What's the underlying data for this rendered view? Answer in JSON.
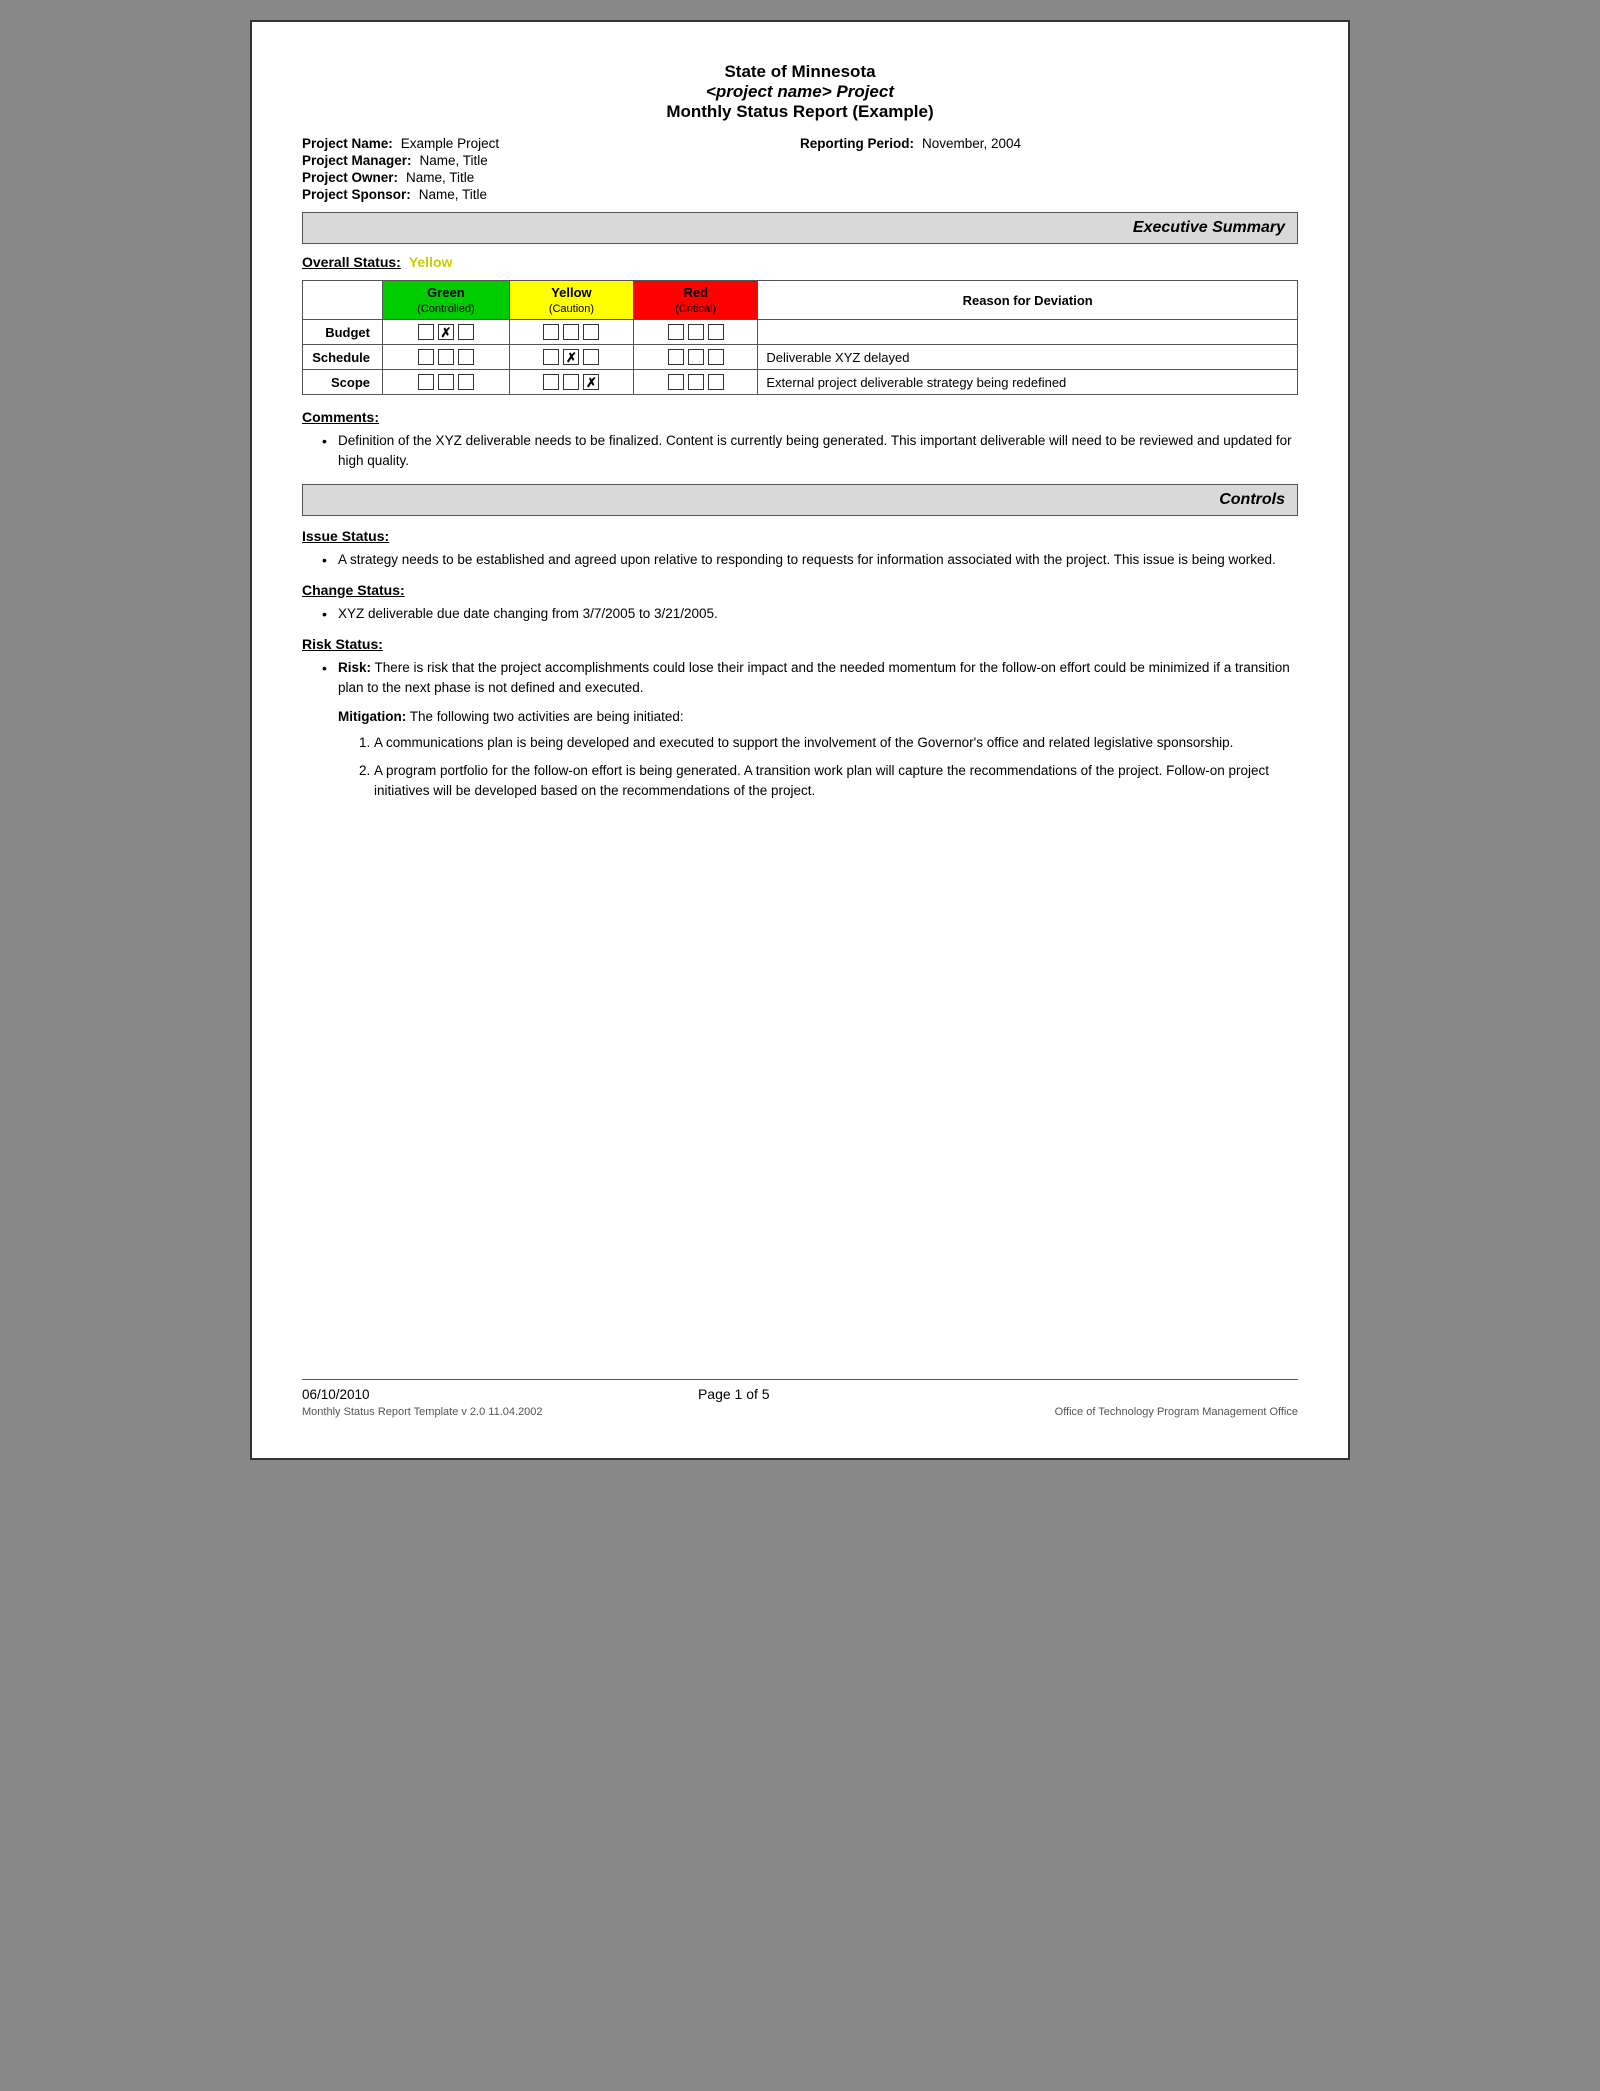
{
  "header": {
    "line1": "State of Minnesota",
    "line2": "<project name> Project",
    "line3": "Monthly Status Report (Example)"
  },
  "meta": {
    "project_name_label": "Project Name:",
    "project_name_value": "Example Project",
    "reporting_period_label": "Reporting Period:",
    "reporting_period_value": "November, 2004",
    "project_manager_label": "Project Manager:",
    "project_manager_value": "Name, Title",
    "project_owner_label": "Project Owner:",
    "project_owner_value": "Name, Title",
    "project_sponsor_label": "Project Sponsor:",
    "project_sponsor_value": "Name, Title"
  },
  "executive_summary": {
    "section_title": "Executive Summary"
  },
  "overall_status": {
    "label": "Overall Status:",
    "value": "Yellow"
  },
  "status_table": {
    "headers": {
      "green": "Green",
      "green_sub": "(Controlled)",
      "yellow": "Yellow",
      "yellow_sub": "(Caution)",
      "red": "Red",
      "red_sub": "(Critical)",
      "reason": "Reason for Deviation"
    },
    "rows": [
      {
        "label": "Budget",
        "green": [
          false,
          true,
          false
        ],
        "yellow": [
          false,
          false,
          false
        ],
        "red": [
          false,
          false,
          false
        ],
        "reason": ""
      },
      {
        "label": "Schedule",
        "green": [
          false,
          false,
          false
        ],
        "yellow": [
          false,
          true,
          false
        ],
        "red": [
          false,
          false,
          false
        ],
        "reason": "Deliverable XYZ delayed"
      },
      {
        "label": "Scope",
        "green": [
          false,
          false,
          false
        ],
        "yellow": [
          false,
          false,
          true
        ],
        "red": [
          false,
          false,
          false
        ],
        "reason": "External project deliverable strategy being redefined"
      }
    ]
  },
  "comments": {
    "title": "Comments:",
    "items": [
      "Definition of the XYZ deliverable needs to be finalized.  Content is currently being generated.  This important deliverable will need to be reviewed and updated for high quality."
    ]
  },
  "controls": {
    "section_title": "Controls",
    "issue_status": {
      "title": "Issue Status:",
      "items": [
        "A strategy needs to be established and agreed upon relative to responding to requests for information associated with the project.  This issue is being worked."
      ]
    },
    "change_status": {
      "title": "Change Status:",
      "items": [
        "XYZ deliverable due date changing from 3/7/2005 to 3/21/2005."
      ]
    },
    "risk_status": {
      "title": "Risk Status:",
      "risk_label": "Risk:",
      "risk_text": "There is risk that the project accomplishments could lose their impact and the needed momentum for the follow-on effort could be minimized if a transition plan to the next phase is not defined and executed.",
      "mitigation_label": "Mitigation:",
      "mitigation_intro": "The following two activities are being initiated:",
      "mitigation_items": [
        "A communications plan is being developed and executed to support the involvement of the Governor's office and related legislative sponsorship.",
        "A program portfolio for the follow-on effort is being generated. A transition work plan will capture the recommendations of the project. Follow-on project initiatives will be developed based on the recommendations of the project."
      ]
    }
  },
  "footer": {
    "date": "06/10/2010",
    "page_label": "Page 1 of 5",
    "template_info": "Monthly Status Report Template  v 2.0  11.04.2002",
    "office": "Office of Technology Program Management Office"
  }
}
